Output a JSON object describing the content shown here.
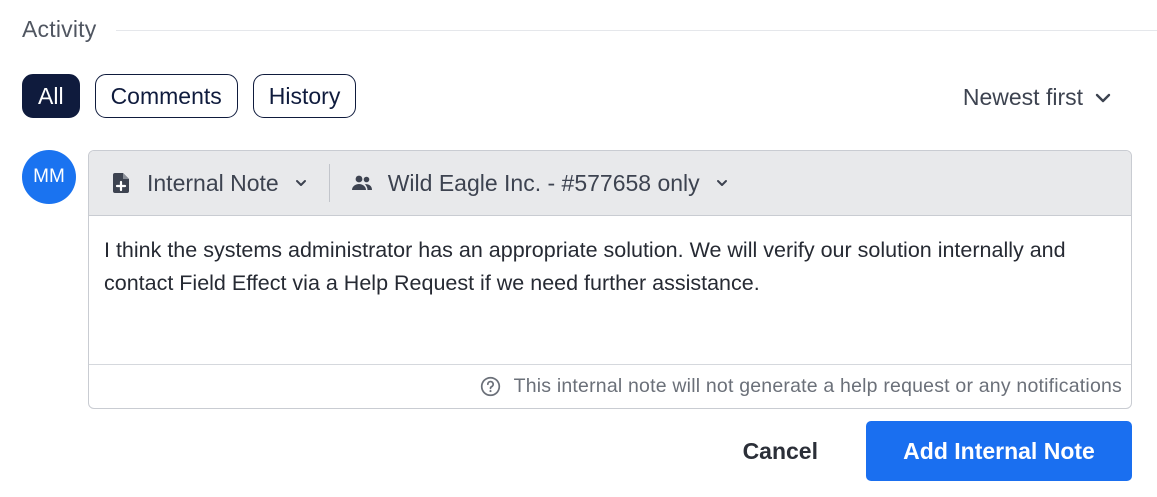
{
  "activity": {
    "title": "Activity",
    "filters": [
      {
        "label": "All",
        "active": true
      },
      {
        "label": "Comments",
        "active": false
      },
      {
        "label": "History",
        "active": false
      }
    ],
    "sort": {
      "label": "Newest first",
      "icon": "chevron-down-icon"
    }
  },
  "user": {
    "initials": "MM"
  },
  "composer": {
    "note_type": {
      "label": "Internal Note",
      "icon": "note-add-icon"
    },
    "visibility": {
      "label": "Wild Eagle Inc. - #577658 only",
      "icon": "people-icon"
    },
    "body": "I think the systems administrator has an appropriate solution. We will verify our solution internally and contact Field Effect via a Help Request if we need further assistance.",
    "notice": "This internal note will not generate a help request or any notifications"
  },
  "actions": {
    "cancel_label": "Cancel",
    "submit_label": "Add Internal Note"
  },
  "colors": {
    "primary": "#1a6ff0",
    "avatar": "#1a73f0",
    "pill_active": "#0f1b3d"
  }
}
